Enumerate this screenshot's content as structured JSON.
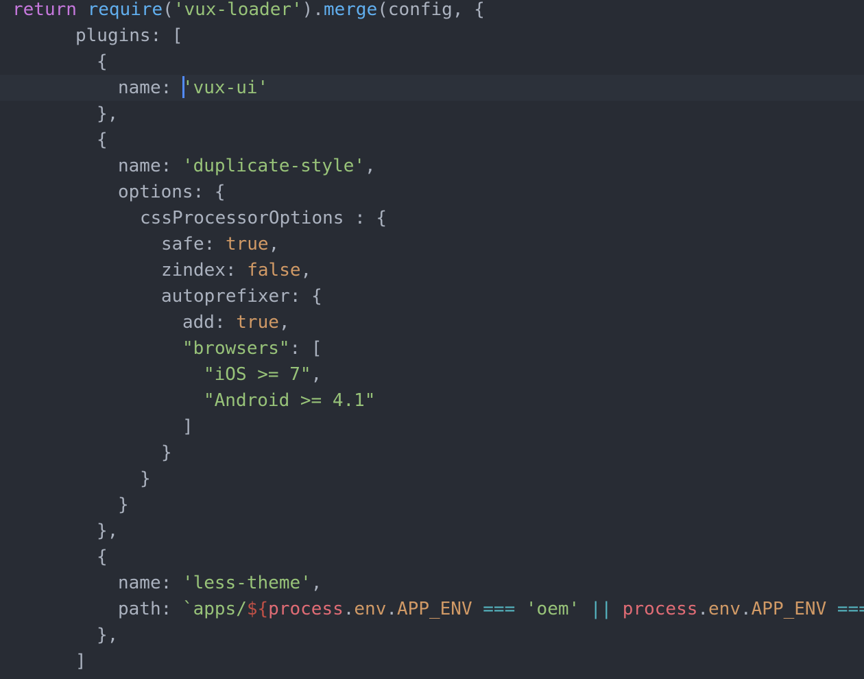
{
  "editor": {
    "colors": {
      "background": "#282c34",
      "active_line": "#2c313a",
      "cursor": "#528bff",
      "keyword": "#c678dd",
      "function": "#61afef",
      "string": "#98c379",
      "number_boolean": "#d19a66",
      "operator": "#56b6c2",
      "variable": "#e06c75",
      "text": "#abb2bf"
    },
    "lines": [
      {
        "tokens": [
          {
            "t": "return",
            "c": "kw"
          },
          {
            "t": " ",
            "c": "punc"
          },
          {
            "t": "require",
            "c": "fn"
          },
          {
            "t": "(",
            "c": "punc"
          },
          {
            "t": "'vux-loader'",
            "c": "str"
          },
          {
            "t": ").",
            "c": "punc"
          },
          {
            "t": "merge",
            "c": "fn"
          },
          {
            "t": "(config, {",
            "c": "punc"
          }
        ]
      },
      {
        "tokens": [
          {
            "t": "plugins",
            "c": "prop"
          },
          {
            "t": ": [",
            "c": "punc"
          }
        ]
      },
      {
        "tokens": [
          {
            "t": "{",
            "c": "punc"
          }
        ]
      },
      {
        "tokens": [
          {
            "t": "name",
            "c": "prop"
          },
          {
            "t": ": ",
            "c": "punc"
          },
          {
            "t": "'vux-ui'",
            "c": "str"
          }
        ],
        "active": true
      },
      {
        "tokens": [
          {
            "t": "},",
            "c": "punc"
          }
        ]
      },
      {
        "tokens": [
          {
            "t": "{",
            "c": "punc"
          }
        ]
      },
      {
        "tokens": [
          {
            "t": "name",
            "c": "prop"
          },
          {
            "t": ": ",
            "c": "punc"
          },
          {
            "t": "'duplicate-style'",
            "c": "str"
          },
          {
            "t": ",",
            "c": "punc"
          }
        ]
      },
      {
        "tokens": [
          {
            "t": "options",
            "c": "prop"
          },
          {
            "t": ": {",
            "c": "punc"
          }
        ]
      },
      {
        "tokens": [
          {
            "t": "cssProcessorOptions",
            "c": "prop"
          },
          {
            "t": " : {",
            "c": "punc"
          }
        ]
      },
      {
        "tokens": [
          {
            "t": "safe",
            "c": "prop"
          },
          {
            "t": ": ",
            "c": "punc"
          },
          {
            "t": "true",
            "c": "bool"
          },
          {
            "t": ",",
            "c": "punc"
          }
        ]
      },
      {
        "tokens": [
          {
            "t": "zindex",
            "c": "prop"
          },
          {
            "t": ": ",
            "c": "punc"
          },
          {
            "t": "false",
            "c": "bool"
          },
          {
            "t": ",",
            "c": "punc"
          }
        ]
      },
      {
        "tokens": [
          {
            "t": "autoprefixer",
            "c": "prop"
          },
          {
            "t": ": {",
            "c": "punc"
          }
        ]
      },
      {
        "tokens": [
          {
            "t": "add",
            "c": "prop"
          },
          {
            "t": ": ",
            "c": "punc"
          },
          {
            "t": "true",
            "c": "bool"
          },
          {
            "t": ",",
            "c": "punc"
          }
        ]
      },
      {
        "tokens": [
          {
            "t": "\"browsers\"",
            "c": "str"
          },
          {
            "t": ": [",
            "c": "punc"
          }
        ]
      },
      {
        "tokens": [
          {
            "t": "\"iOS >= 7\"",
            "c": "str"
          },
          {
            "t": ",",
            "c": "punc"
          }
        ]
      },
      {
        "tokens": [
          {
            "t": "\"Android >= 4.1\"",
            "c": "str"
          }
        ]
      },
      {
        "tokens": [
          {
            "t": "]",
            "c": "punc"
          }
        ]
      },
      {
        "tokens": [
          {
            "t": "}",
            "c": "punc"
          }
        ]
      },
      {
        "tokens": [
          {
            "t": "}",
            "c": "punc"
          }
        ]
      },
      {
        "tokens": [
          {
            "t": "}",
            "c": "punc"
          }
        ]
      },
      {
        "tokens": [
          {
            "t": "},",
            "c": "punc"
          }
        ]
      },
      {
        "tokens": [
          {
            "t": "{",
            "c": "punc"
          }
        ]
      },
      {
        "tokens": [
          {
            "t": "name",
            "c": "prop"
          },
          {
            "t": ": ",
            "c": "punc"
          },
          {
            "t": "'less-theme'",
            "c": "str"
          },
          {
            "t": ",",
            "c": "punc"
          }
        ]
      },
      {
        "tokens": [
          {
            "t": "path",
            "c": "prop"
          },
          {
            "t": ": ",
            "c": "punc"
          },
          {
            "t": "`apps/",
            "c": "tmpl"
          },
          {
            "t": "${",
            "c": "interp"
          },
          {
            "t": "process",
            "c": "var"
          },
          {
            "t": ".",
            "c": "punc"
          },
          {
            "t": "env",
            "c": "envp"
          },
          {
            "t": ".",
            "c": "punc"
          },
          {
            "t": "APP_ENV",
            "c": "envp"
          },
          {
            "t": " ",
            "c": "punc"
          },
          {
            "t": "===",
            "c": "op"
          },
          {
            "t": " ",
            "c": "punc"
          },
          {
            "t": "'oem'",
            "c": "str"
          },
          {
            "t": " ",
            "c": "punc"
          },
          {
            "t": "||",
            "c": "op"
          },
          {
            "t": " ",
            "c": "punc"
          },
          {
            "t": "process",
            "c": "var"
          },
          {
            "t": ".",
            "c": "punc"
          },
          {
            "t": "env",
            "c": "envp"
          },
          {
            "t": ".",
            "c": "punc"
          },
          {
            "t": "APP_ENV",
            "c": "envp"
          },
          {
            "t": " ",
            "c": "punc"
          },
          {
            "t": "===",
            "c": "op"
          }
        ]
      },
      {
        "tokens": [
          {
            "t": "},",
            "c": "punc"
          }
        ]
      },
      {
        "tokens": [
          {
            "t": "]",
            "c": "punc"
          }
        ]
      }
    ]
  }
}
